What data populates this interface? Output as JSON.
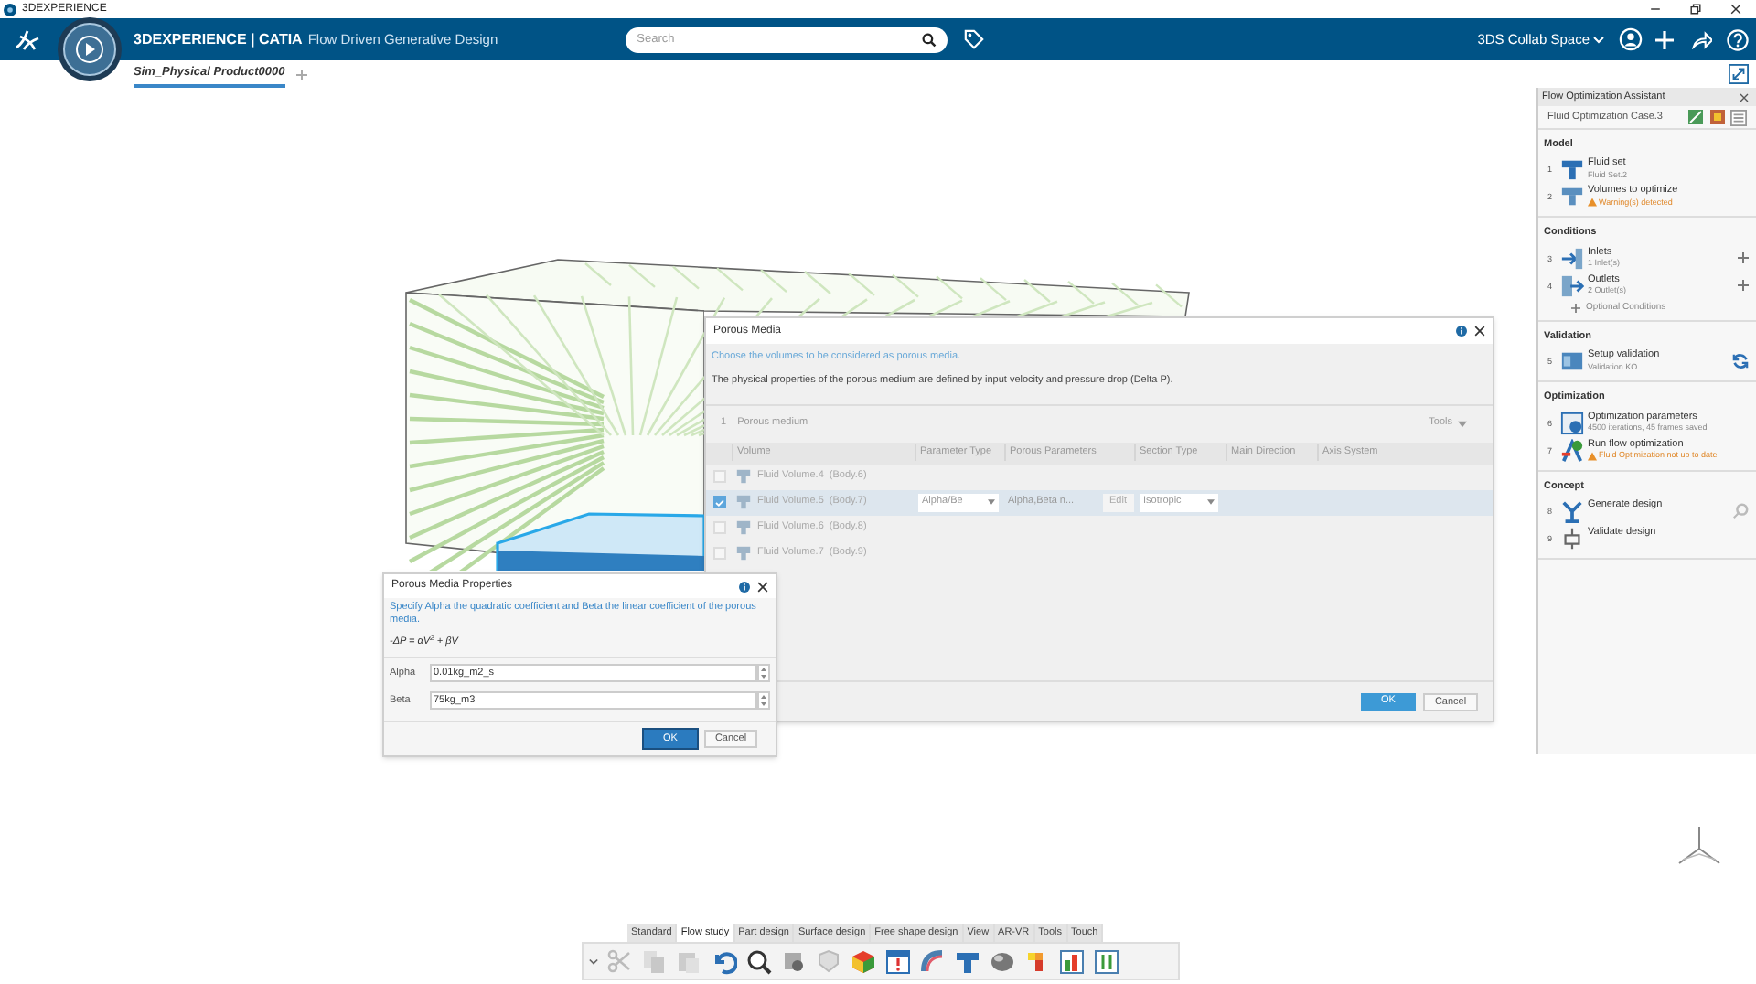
{
  "window": {
    "title": "3DEXPERIENCE"
  },
  "top_bar": {
    "brand": "3DEXPERIENCE | CATIA",
    "app": "Flow Driven Generative Design",
    "search": {
      "placeholder": "Search"
    },
    "space": "3DS Collab Space"
  },
  "tabs": [
    {
      "label": "Sim_Physical Product0000",
      "selected": true
    }
  ],
  "assistant": {
    "title": "Flow Optimization Assistant",
    "case": "Fluid Optimization Case.3",
    "sections": [
      {
        "title": "Model",
        "steps": [
          {
            "number": "1",
            "title": "Fluid set",
            "detail": "Fluid Set.2",
            "warning": false,
            "kind": "plain"
          },
          {
            "number": "2",
            "title": "Volumes to optimize",
            "detail": "Warning(s) detected",
            "warning": true,
            "kind": "plain"
          }
        ]
      },
      {
        "title": "Conditions",
        "steps": [
          {
            "number": "3",
            "title": "Inlets",
            "detail": "1 Inlet(s)",
            "warning": false,
            "kind": "add"
          },
          {
            "number": "4",
            "title": "Outlets",
            "detail": "2 Outlet(s)",
            "warning": false,
            "kind": "add"
          }
        ],
        "extra": "Optional Conditions"
      },
      {
        "title": "Validation",
        "steps": [
          {
            "number": "5",
            "title": "Setup validation",
            "detail": "Validation KO",
            "warning": false,
            "kind": "refresh"
          }
        ]
      },
      {
        "title": "Optimization",
        "steps": [
          {
            "number": "6",
            "title": "Optimization parameters",
            "detail": "4500 iterations, 45 frames saved",
            "warning": false,
            "kind": "plain"
          },
          {
            "number": "7",
            "title": "Run flow optimization",
            "detail": "Fluid Optimization not up to date",
            "warning": true,
            "kind": "plain"
          }
        ]
      },
      {
        "title": "Concept",
        "steps": [
          {
            "number": "8",
            "title": "Generate design",
            "kind": "settings"
          },
          {
            "number": "9",
            "title": "Validate design",
            "kind": "plain"
          }
        ]
      }
    ]
  },
  "porous_dialog": {
    "title": "Porous Media",
    "instruction": "Choose the volumes to be considered as porous media.",
    "description": "The physical properties of the porous medium are defined by input velocity and pressure drop (Delta P).",
    "group_number": "1",
    "group": "Porous medium",
    "tools": "Tools",
    "columns": [
      "Volume",
      "Parameter Type",
      "Porous Parameters",
      "Section Type",
      "Main Direction",
      "Axis System"
    ],
    "rows": [
      {
        "volume": "Fluid Volume.4  (Body.6)",
        "checked": false,
        "selected": false
      },
      {
        "volume": "Fluid Volume.5  (Body.7)",
        "checked": true,
        "selected": true,
        "parameter_type": "Alpha/Be",
        "porous_parameters": "Alpha,Beta n...",
        "edit": "Edit",
        "section_type": "Isotropic"
      },
      {
        "volume": "Fluid Volume.6  (Body.8)",
        "checked": false,
        "selected": false
      },
      {
        "volume": "Fluid Volume.7  (Body.9)",
        "checked": false,
        "selected": false
      }
    ],
    "buttons": [
      "OK",
      "Cancel"
    ]
  },
  "properties_dialog": {
    "title": "Porous Media Properties",
    "instruction": "Specify Alpha the quadratic coefficient and Beta the linear coefficient of the porous media.",
    "formula": "-ΔP = αV$^{2}$ + βV",
    "fields": [
      {
        "label": "Alpha",
        "value": "0.01kg_m2_s"
      },
      {
        "label": "Beta",
        "value": "75kg_m3"
      }
    ],
    "buttons": [
      {
        "label": "OK",
        "focused": true
      },
      {
        "label": "Cancel",
        "focused": false
      }
    ]
  },
  "toolbar": {
    "tabs": [
      {
        "label": "Standard",
        "selected": false
      },
      {
        "label": "Flow study",
        "selected": true
      },
      {
        "label": "Part design",
        "selected": false
      },
      {
        "label": "Surface design",
        "selected": false
      },
      {
        "label": "Free shape design",
        "selected": false
      },
      {
        "label": "View",
        "selected": false
      },
      {
        "label": "AR-VR",
        "selected": false
      },
      {
        "label": "Tools",
        "selected": false
      },
      {
        "label": "Touch",
        "selected": false
      }
    ]
  }
}
